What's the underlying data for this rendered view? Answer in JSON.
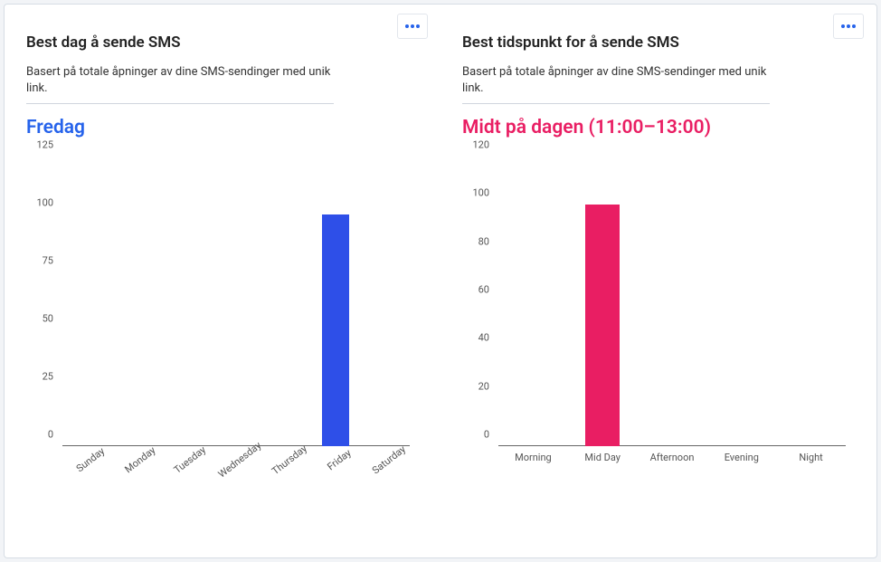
{
  "left": {
    "title": "Best dag å sende SMS",
    "subtitle": "Basert på totale åpninger av dine SMS-sendinger med unik link.",
    "highlight": "Fredag",
    "color": "#2E4FE8"
  },
  "right": {
    "title": "Best tidspunkt for å sende SMS",
    "subtitle": "Basert på totale åpninger av dine SMS-sendinger med unik link.",
    "highlight": "Midt på dagen (11:00–13:00)",
    "color": "#E91E63"
  },
  "chart_data": [
    {
      "type": "bar",
      "title": "Best dag å sende SMS",
      "categories": [
        "Sunday",
        "Monday",
        "Tuesday",
        "Wednesday",
        "Thursday",
        "Friday",
        "Saturday"
      ],
      "values": [
        0,
        0,
        0,
        0,
        0,
        100,
        0
      ],
      "ylim": [
        0,
        125
      ],
      "yticks": [
        0,
        25,
        50,
        75,
        100,
        125
      ],
      "color": "#2E4FE8",
      "x_rotated": true
    },
    {
      "type": "bar",
      "title": "Best tidspunkt for å sende SMS",
      "categories": [
        "Morning",
        "Mid Day",
        "Afternoon",
        "Evening",
        "Night"
      ],
      "values": [
        0,
        100,
        0,
        0,
        0
      ],
      "ylim": [
        0,
        120
      ],
      "yticks": [
        0,
        20,
        40,
        60,
        80,
        100,
        120
      ],
      "color": "#E91E63",
      "x_rotated": false
    }
  ]
}
